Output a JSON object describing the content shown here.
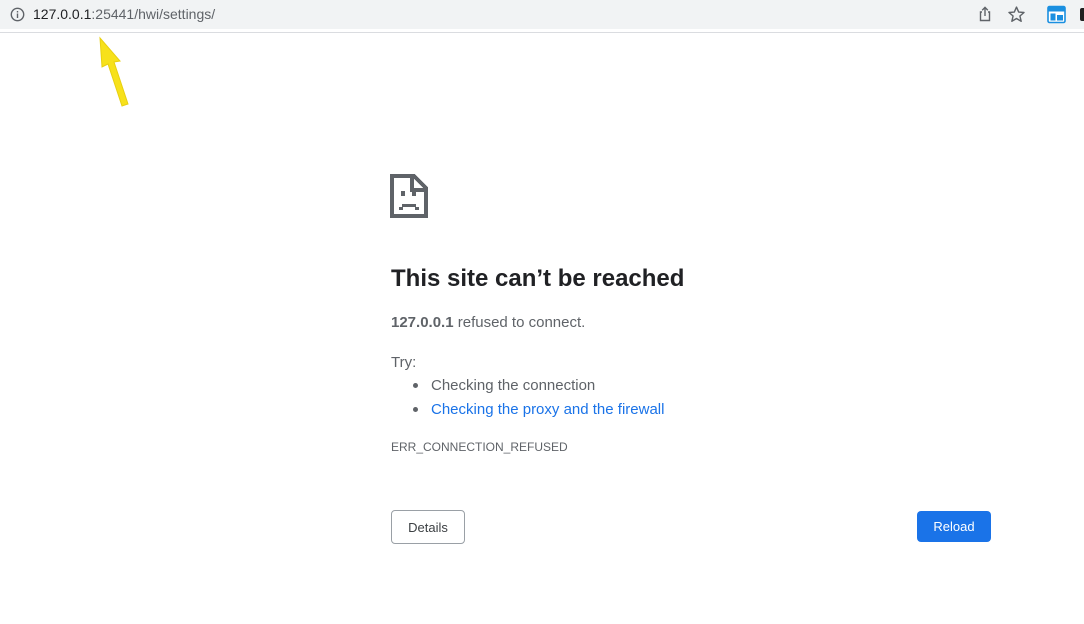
{
  "browser": {
    "url_host": "127.0.0.1",
    "url_rest": ":25441/hwi/settings/",
    "icons": {
      "info": "info-icon",
      "share": "share-icon",
      "bookmark": "star-icon",
      "extension": "extension-icon"
    }
  },
  "error_page": {
    "title": "This site can’t be reached",
    "host": "127.0.0.1",
    "message": " refused to connect.",
    "try_label": "Try:",
    "suggestions": [
      "Checking the connection",
      "Checking the proxy and the firewall"
    ],
    "error_code": "ERR_CONNECTION_REFUSED",
    "details_label": "Details",
    "reload_label": "Reload"
  },
  "colors": {
    "accent": "#1a73e8",
    "annotation_arrow": "#f7e11b"
  }
}
